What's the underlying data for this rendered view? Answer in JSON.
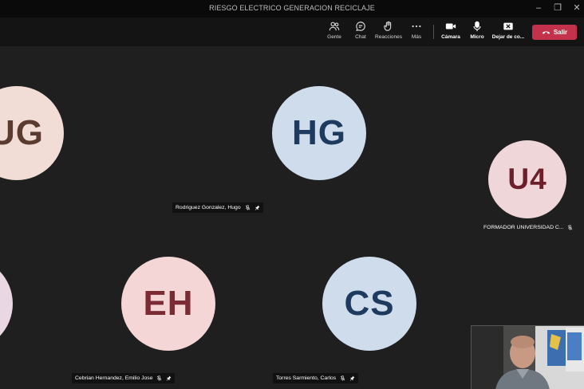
{
  "window": {
    "title": "RIESGO ELECTRICO GENERACION RECICLAJE",
    "minimize": "–",
    "maximize": "❐",
    "close": "✕"
  },
  "toolbar": {
    "people": "Gente",
    "chat": "Chat",
    "reactions": "Reacciones",
    "more": "Más",
    "camera": "Cámara",
    "mic": "Micro",
    "share": "Dejar de co...",
    "leave": "Salir"
  },
  "participants": [
    {
      "initials": "UG",
      "name": ""
    },
    {
      "initials": "HG",
      "name": "Rodriguez Gonzalez, Hugo"
    },
    {
      "initials": "U4",
      "name": "FORMADOR UNIVERSIDAD C..."
    },
    {
      "initials": "EH",
      "name": "Cebrian Hernandez, Emilio Jose"
    },
    {
      "initials": "CS",
      "name": "Torres Sarmiento, Carlos"
    }
  ],
  "colors": {
    "leave": "#c4314b",
    "stage": "#1f1f1f",
    "toolbar": "#141414"
  }
}
